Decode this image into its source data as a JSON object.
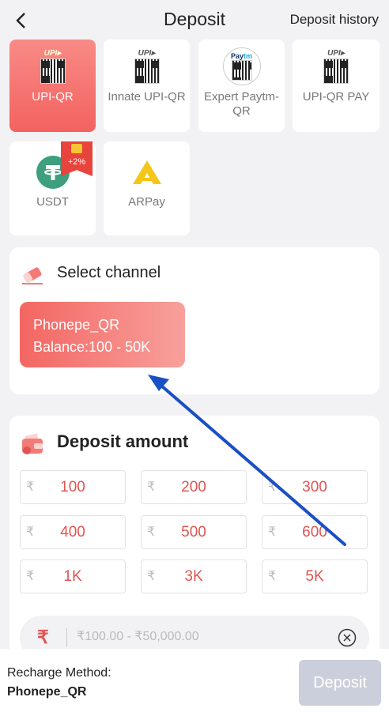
{
  "header": {
    "title": "Deposit",
    "history_label": "Deposit history",
    "back_icon": "chevron-left-icon"
  },
  "methods": [
    {
      "label": "UPI-QR",
      "active": true,
      "icon": "upi-qr-icon"
    },
    {
      "label": "Innate UPI-QR",
      "active": false,
      "icon": "upi-qr-icon"
    },
    {
      "label": "Expert Paytm-QR",
      "active": false,
      "icon": "paytm-qr-icon"
    },
    {
      "label": "UPI-QR PAY",
      "active": false,
      "icon": "upi-qr-icon"
    },
    {
      "label": "USDT",
      "active": false,
      "icon": "tether-icon",
      "badge": "+2%"
    },
    {
      "label": "ARPay",
      "active": false,
      "icon": "arpay-icon"
    }
  ],
  "channel": {
    "title": "Select channel",
    "items": [
      {
        "name": "Phonepe_QR",
        "balance": "Balance:100 - 50K"
      }
    ]
  },
  "amount": {
    "title": "Deposit amount",
    "currency_symbol": "₹",
    "options": [
      "100",
      "200",
      "300",
      "400",
      "500",
      "600",
      "1K",
      "3K",
      "5K"
    ],
    "input_placeholder": "₹100.00 - ₹50,000.00",
    "input_value": ""
  },
  "footer": {
    "method_label": "Recharge Method:",
    "method_value": "Phonepe_QR",
    "deposit_label": "Deposit"
  },
  "colors": {
    "accent": "#f3625f",
    "amount_text": "#e05452",
    "button_disabled": "#cbcfdc",
    "annotation_arrow": "#1b4fc4"
  }
}
